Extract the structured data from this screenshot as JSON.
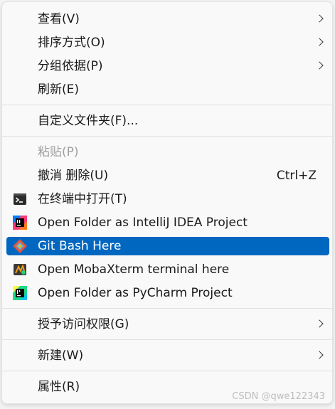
{
  "menu": {
    "items": [
      {
        "label": "查看(V)",
        "submenu": true
      },
      {
        "label": "排序方式(O)",
        "submenu": true
      },
      {
        "label": "分组依据(P)",
        "submenu": true
      },
      {
        "label": "刷新(E)"
      },
      {
        "label": "自定义文件夹(F)..."
      },
      {
        "label": "粘贴(P)",
        "disabled": true
      },
      {
        "label": "撤消 删除(U)",
        "shortcut": "Ctrl+Z"
      },
      {
        "label": "在终端中打开(T)",
        "icon": "terminal-icon"
      },
      {
        "label": "Open Folder as IntelliJ IDEA Project",
        "icon": "intellij-idea-icon"
      },
      {
        "label": "Git Bash Here",
        "icon": "git-icon",
        "highlighted": true
      },
      {
        "label": "Open MobaXterm terminal here",
        "icon": "mobaxterm-icon"
      },
      {
        "label": "Open Folder as PyCharm Project",
        "icon": "pycharm-icon"
      },
      {
        "label": "授予访问权限(G)",
        "submenu": true
      },
      {
        "label": "新建(W)",
        "submenu": true
      },
      {
        "label": "属性(R)"
      }
    ]
  },
  "watermark": "CSDN @qwe122343",
  "colors": {
    "highlight": "#0067c0",
    "disabled_text": "#9e9e9e",
    "menu_bg": "#f9f9f9"
  }
}
